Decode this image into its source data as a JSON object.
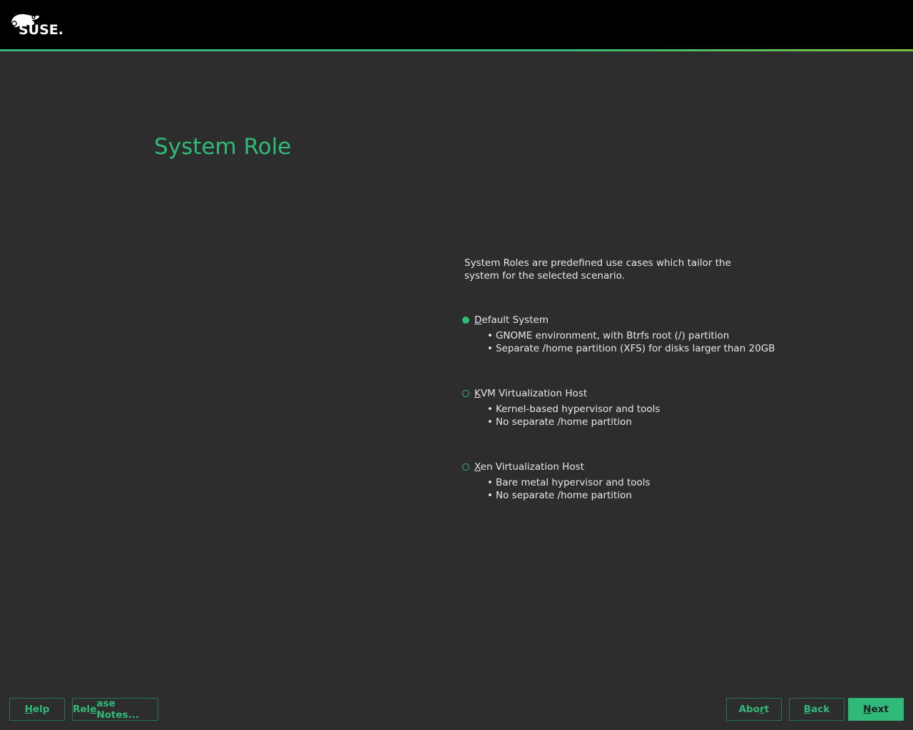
{
  "header": {
    "logo_text": "SUSE."
  },
  "page": {
    "title": "System Role",
    "description": "System Roles are predefined use cases which tailor the system for the selected scenario."
  },
  "roles": [
    {
      "mnemonic": "D",
      "label_rest": "efault System",
      "selected": true,
      "bullets": [
        "GNOME environment, with Btrfs root (/) partition",
        "Separate /home partition (XFS) for disks larger than 20GB"
      ]
    },
    {
      "mnemonic": "K",
      "label_rest": "VM Virtualization Host",
      "selected": false,
      "bullets": [
        "Kernel-based hypervisor and tools",
        "No separate /home partition"
      ]
    },
    {
      "mnemonic": "X",
      "label_rest": "en Virtualization Host",
      "selected": false,
      "bullets": [
        "Bare metal hypervisor and tools",
        "No separate /home partition"
      ]
    }
  ],
  "buttons": {
    "help": {
      "mnemonic": "H",
      "rest": "elp"
    },
    "release_notes": {
      "pre": "Rel",
      "mnemonic": "e",
      "rest": "ase Notes..."
    },
    "abort": {
      "pre": "Abo",
      "mnemonic": "r",
      "rest": "t"
    },
    "back": {
      "mnemonic": "B",
      "rest": "ack"
    },
    "next": {
      "mnemonic": "N",
      "rest": "ext"
    }
  },
  "colors": {
    "accent": "#30ba78",
    "background": "#2d2d2d",
    "header": "#000000"
  }
}
